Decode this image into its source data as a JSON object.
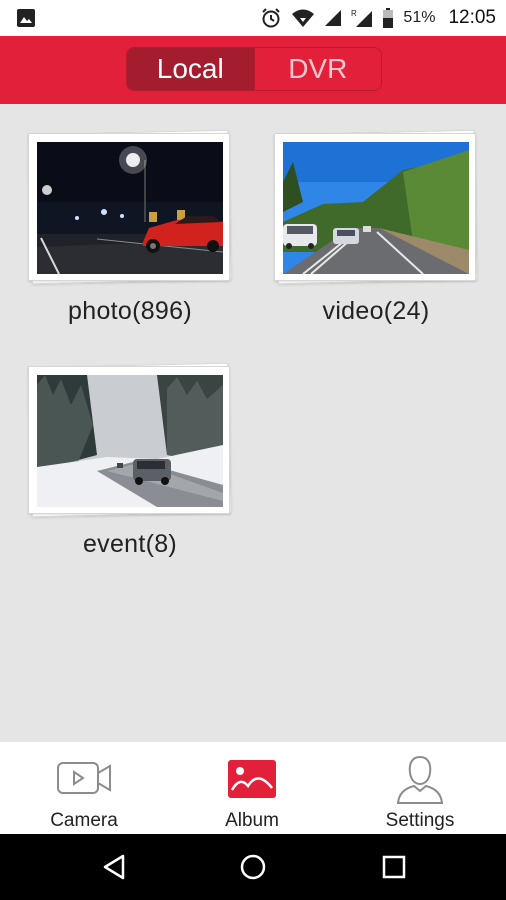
{
  "status_bar": {
    "battery_percent": "51%",
    "time": "12:05",
    "icons": [
      "image-notification-icon",
      "alarm-icon",
      "wifi-icon",
      "cell-signal-icon",
      "roaming-signal-icon",
      "battery-icon"
    ]
  },
  "header": {
    "tabs": [
      {
        "label": "Local",
        "active": true
      },
      {
        "label": "DVR",
        "active": false
      }
    ],
    "colors": {
      "accent": "#e3203a",
      "active_tab": "#a41d2f"
    }
  },
  "albums": [
    {
      "label": "photo(896)",
      "thumbnail": "night street with red car"
    },
    {
      "label": "video(24)",
      "thumbnail": "mountain road with cars"
    },
    {
      "label": "event(8)",
      "thumbnail": "snowy forest road with car"
    }
  ],
  "bottom_nav": {
    "items": [
      {
        "label": "Camera",
        "icon": "camera-icon",
        "active": false
      },
      {
        "label": "Album",
        "icon": "album-icon",
        "active": true
      },
      {
        "label": "Settings",
        "icon": "settings-person-icon",
        "active": false
      }
    ]
  },
  "system_nav": {
    "buttons": [
      "back-icon",
      "home-icon",
      "recents-icon"
    ]
  }
}
